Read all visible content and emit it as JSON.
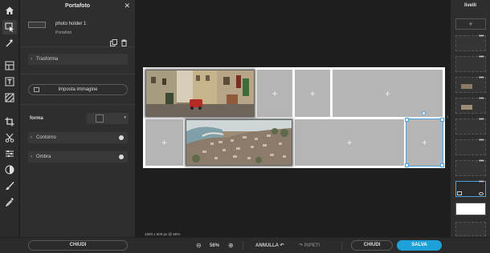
{
  "panel": {
    "title": "Portafoto",
    "close_icon": "close-icon",
    "layer": {
      "name": "photo holder 1",
      "type": "Portafoto"
    },
    "sections": {
      "trasforma": "Trasforma",
      "imposta_immagine": "Imposta immagine",
      "forma": "forma",
      "contorno": "Contorno",
      "ombra": "Ombra"
    },
    "toggles": {
      "contorno": false,
      "ombra": false
    },
    "chiudi": "CHIUDI"
  },
  "toolbar": {
    "icons": [
      "home-icon",
      "select-icon",
      "magic-icon",
      "layout-icon",
      "text-icon",
      "pattern-icon",
      "crop-icon",
      "cut-icon",
      "adjust-icon",
      "filter-icon",
      "brush-icon",
      "eyedropper-icon",
      "settings-icon"
    ]
  },
  "canvas": {
    "dimensions_label": "1500 x 500 px @ 56%",
    "placeholder_symbol": "+"
  },
  "bottombar": {
    "zoom": "56%",
    "annulla": "ANNULLA",
    "ripeti": "RIPETI",
    "chiudi": "CHIUDI",
    "salva": "SALVA"
  },
  "layers": {
    "title": "livelli",
    "add_symbol": "+",
    "more_symbol": "•••"
  },
  "colors": {
    "accent": "#1ea1d9",
    "panel_bg": "#2e2e2e",
    "app_bg": "#1e1e1e",
    "placeholder": "#b5b5b5"
  }
}
